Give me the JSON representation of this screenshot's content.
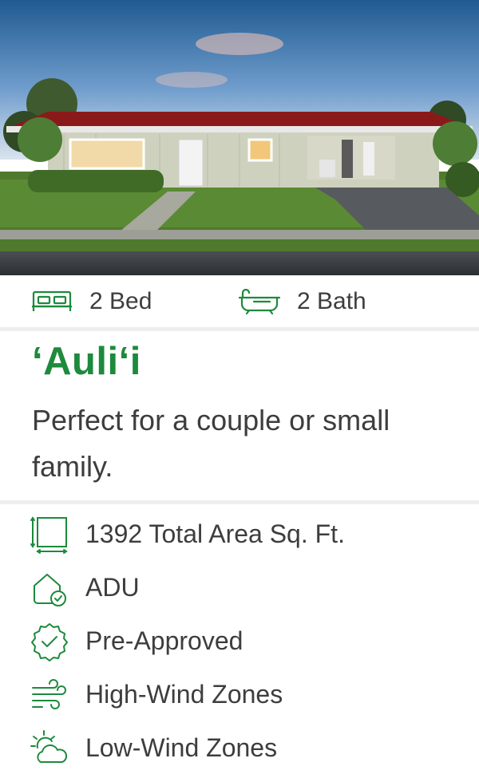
{
  "hero": {
    "image_alt": "house-rendering"
  },
  "stats": {
    "bedrooms": {
      "icon": "bed-icon",
      "label": "2 Bed"
    },
    "bathrooms": {
      "icon": "bathtub-icon",
      "label": "2 Bath"
    }
  },
  "plan": {
    "name": "‘Auli‘i",
    "description": "Perfect for a couple or small family."
  },
  "features": [
    {
      "icon": "area-icon",
      "label": "1392 Total Area Sq. Ft."
    },
    {
      "icon": "house-check-icon",
      "label": "ADU"
    },
    {
      "icon": "badge-check-icon",
      "label": "Pre-Approved"
    },
    {
      "icon": "wind-icon",
      "label": "High-Wind Zones"
    },
    {
      "icon": "sun-cloud-icon",
      "label": "Low-Wind Zones"
    }
  ],
  "colors": {
    "accent": "#1d8a3c",
    "text": "#3d3d3d",
    "divider": "#eeeeee"
  }
}
